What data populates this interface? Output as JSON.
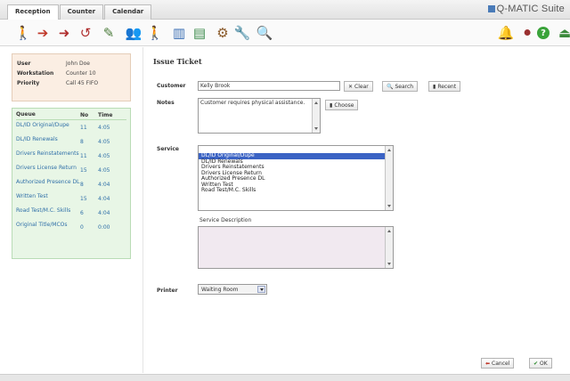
{
  "tabs": [
    "Reception",
    "Counter",
    "Calendar"
  ],
  "brand": "Q-MATIC Suite",
  "toolbar": [
    {
      "icon": "person-add-icon",
      "glyph": "🚶",
      "color": "#4a8a3a"
    },
    {
      "icon": "call-next-icon",
      "glyph": "➔",
      "color": "#c0392b"
    },
    {
      "icon": "transfer-icon",
      "glyph": "➜",
      "color": "#b03030"
    },
    {
      "icon": "recall-icon",
      "glyph": "↺",
      "color": "#b03030"
    },
    {
      "icon": "serve-icon",
      "glyph": "✎",
      "color": "#4a7b3a"
    },
    {
      "icon": "queue-people-icon",
      "glyph": "👥",
      "color": "#3e7b3a"
    },
    {
      "icon": "walk-icon",
      "glyph": "🚶",
      "color": "#3e7b3a"
    },
    {
      "icon": "statistics-icon",
      "glyph": "▥",
      "color": "#3b6fb4"
    },
    {
      "icon": "group-stats-icon",
      "glyph": "▤",
      "color": "#3b8a4b"
    },
    {
      "icon": "tools-icon",
      "glyph": "⚙",
      "color": "#8a5a2a"
    },
    {
      "icon": "wrench-icon",
      "glyph": "🔧",
      "color": "#8a8a8a"
    },
    {
      "icon": "user-search-icon",
      "glyph": "🔍",
      "color": "#7a5a30"
    }
  ],
  "right_tools": [
    {
      "icon": "bell-icon",
      "glyph": "🔔",
      "color": "#c08a1a"
    },
    {
      "icon": "network-icon",
      "glyph": "⚫",
      "color": "#9a3030"
    },
    {
      "icon": "help-icon",
      "glyph": "?",
      "color": "#ffffff"
    },
    {
      "icon": "logout-icon",
      "glyph": "⏏",
      "color": "#3a8a3a"
    }
  ],
  "user_info": [
    {
      "key": "User",
      "value": "John Doe"
    },
    {
      "key": "Workstation",
      "value": "Counter 10"
    },
    {
      "key": "Priority",
      "value": "Call 45 FIFO"
    }
  ],
  "queues": {
    "headers": {
      "name": "Queue",
      "no": "No",
      "time": "Time"
    },
    "rows": [
      {
        "name": "DL/ID Original/Dupe",
        "no": "11",
        "time": "4:05"
      },
      {
        "name": "DL/ID Renewals",
        "no": "8",
        "time": "4:05"
      },
      {
        "name": "Drivers Reinstatements",
        "no": "11",
        "time": "4:05"
      },
      {
        "name": "Drivers License Return",
        "no": "15",
        "time": "4:05"
      },
      {
        "name": "Authorized Presence DL",
        "no": "8",
        "time": "4:04"
      },
      {
        "name": "Written Test",
        "no": "15",
        "time": "4:04"
      },
      {
        "name": "Road Test/M.C. Skills",
        "no": "6",
        "time": "4:04"
      },
      {
        "name": "Original Title/MCOs",
        "no": "0",
        "time": "0:00"
      }
    ]
  },
  "form": {
    "title": "Issue Ticket",
    "customer_label": "Customer",
    "customer_value": "Kelly Brook",
    "clear_label": "Clear",
    "search_label": "Search",
    "recent_label": "Recent",
    "notes_label": "Notes",
    "notes_value": "Customer requires physical assistance.",
    "choose_label": "Choose",
    "service_label": "Service",
    "services": [
      "DL/ID Original/Dupe",
      "DL/ID Renewals",
      "Drivers Reinstatements",
      "Drivers License Return",
      "Authorized Presence DL",
      "Written Test",
      "Road Test/M.C. Skills"
    ],
    "selected_service": "DL/ID Original/Dupe",
    "service_description_label": "Service Description",
    "printer_label": "Printer",
    "printer_value": "Waiting Room",
    "cancel_label": "Cancel",
    "ok_label": "OK"
  }
}
